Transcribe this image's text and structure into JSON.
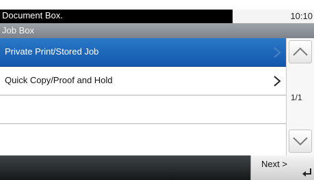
{
  "header": {
    "title": "Document Box.",
    "time": "10:10"
  },
  "subheader": {
    "title": "Job Box"
  },
  "list": {
    "items": [
      {
        "label": "Private Print/Stored Job",
        "selected": true
      },
      {
        "label": "Quick Copy/Proof and Hold",
        "selected": false
      },
      {
        "label": "",
        "selected": false
      },
      {
        "label": "",
        "selected": false
      }
    ]
  },
  "pager": {
    "page": "1/1"
  },
  "footer": {
    "next_label": "Next >"
  },
  "icons": {
    "row_arrow": "chevron-right-icon",
    "scroll_up": "chevron-up-icon",
    "scroll_down": "chevron-down-icon",
    "enter": "enter-icon"
  },
  "colors": {
    "selected_row": "#1e6abb",
    "title_bar": "#000000",
    "subtitle_bar": "#8a9095"
  }
}
